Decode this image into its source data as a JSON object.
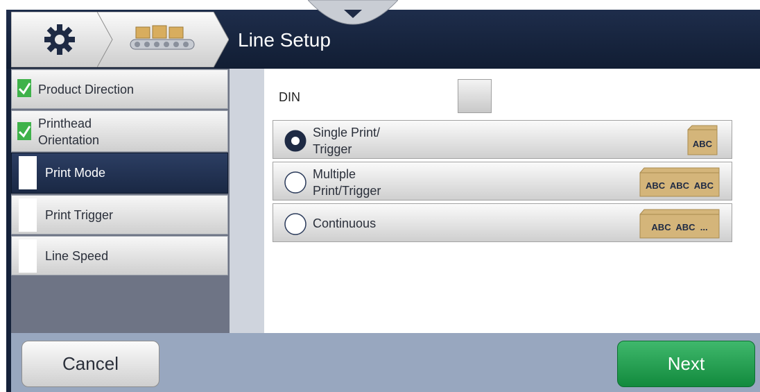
{
  "header": {
    "title": "Line Setup",
    "gear_icon": "gear-icon",
    "line_icon": "conveyor-icon"
  },
  "sidebar": {
    "items": [
      {
        "label_line1": "Product Direction",
        "label_line2": "",
        "state": "complete",
        "icon": "check-icon"
      },
      {
        "label_line1": "Printhead",
        "label_line2": "Orientation",
        "state": "complete",
        "icon": "check-icon"
      },
      {
        "label_line1": "Print Mode",
        "label_line2": "",
        "state": "active",
        "icon": ""
      },
      {
        "label_line1": "Print Trigger",
        "label_line2": "",
        "state": "pending",
        "icon": ""
      },
      {
        "label_line1": "Line Speed",
        "label_line2": "",
        "state": "pending",
        "icon": ""
      }
    ]
  },
  "main": {
    "din_label": "DIN",
    "din_checked": false,
    "options": [
      {
        "line1": "Single Print/",
        "line2": "Trigger",
        "selected": true,
        "box_text": "ABC"
      },
      {
        "line1": "Multiple",
        "line2": "Print/Trigger",
        "selected": false,
        "box_text": "ABC  ABC  ABC"
      },
      {
        "line1": "Continuous",
        "line2": "",
        "selected": false,
        "box_text": "ABC  ABC  ..."
      }
    ]
  },
  "footer": {
    "cancel_label": "Cancel",
    "next_label": "Next"
  },
  "colors": {
    "header": "#15223a",
    "accent_green": "#1f9e4b",
    "check_green": "#3fb24a",
    "box_tan": "#d4b57a"
  }
}
